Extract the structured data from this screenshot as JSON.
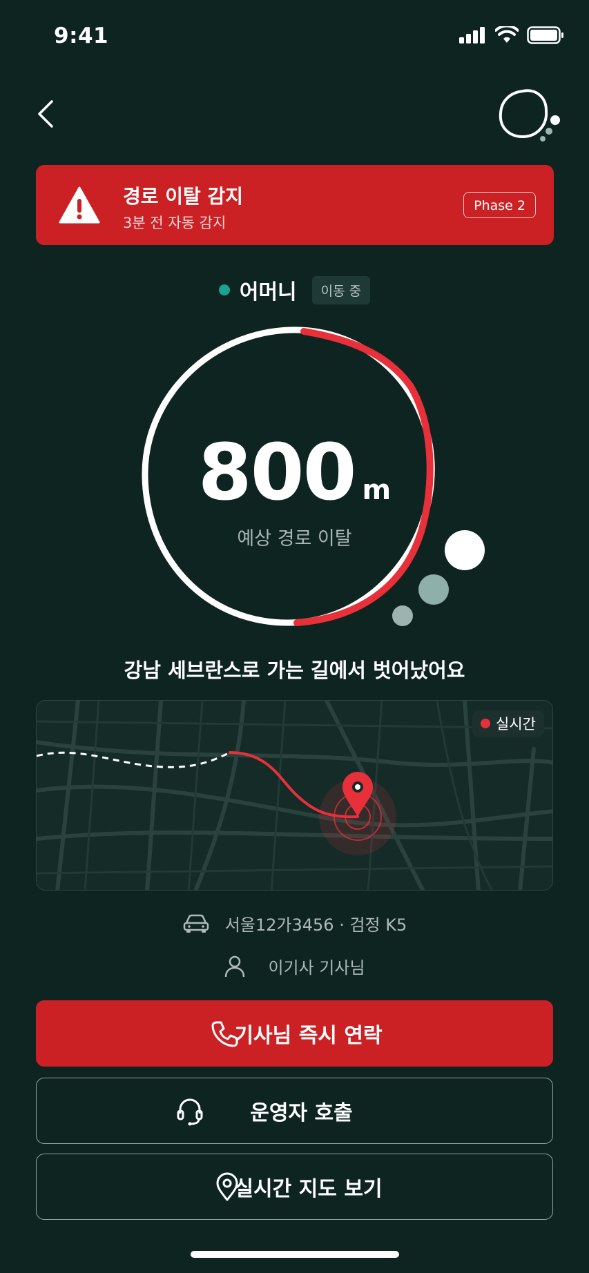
{
  "status_bar": {
    "time": "9:41"
  },
  "alert": {
    "title": "경로 이탈 감지",
    "subtitle": "3분 전 자동 감지",
    "phase": "Phase 2",
    "color": "#cc2124"
  },
  "person": {
    "name": "어머니",
    "status": "이동 중",
    "status_color": "#1aa38e"
  },
  "gauge": {
    "value": "800",
    "unit": "m",
    "label": "예상 경로 이탈",
    "deviation_fraction": 0.42,
    "accent": "#e8303a"
  },
  "message": "강남 세브란스로 가는 길에서 벗어났어요",
  "map": {
    "live_label": "실시간"
  },
  "vehicle": {
    "plate_info": "서울12가3456 · 검정 K5"
  },
  "driver": {
    "name": "이기사 기사님"
  },
  "buttons": {
    "call_driver": "기사님 즉시 연락",
    "call_operator": "운영자 호출",
    "view_map": "실시간 지도 보기"
  },
  "icons": {
    "back": "chevron-left-icon",
    "logo": "bubble-logo-icon",
    "warning": "warning-triangle-icon",
    "car": "car-icon",
    "person": "person-icon",
    "phone": "phone-icon",
    "headset": "headset-icon",
    "location": "location-pin-icon"
  }
}
